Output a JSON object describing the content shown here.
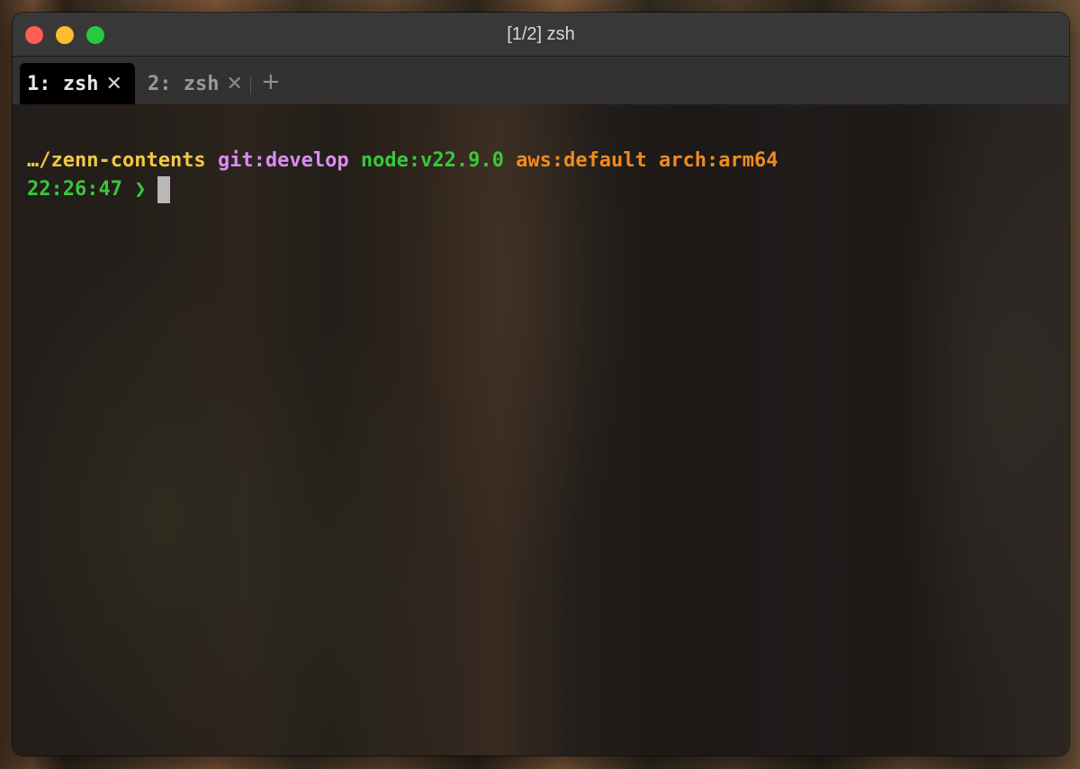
{
  "window": {
    "title": "[1/2] zsh"
  },
  "tabs": [
    {
      "label": "1: zsh",
      "close_icon": "close-icon",
      "active": true
    },
    {
      "label": "2: zsh",
      "close_icon": "close-icon",
      "active": false
    }
  ],
  "new_tab": {
    "icon": "plus-icon",
    "glyph": "+"
  },
  "prompt": {
    "path": "…/zenn-contents",
    "git": "git:develop",
    "node": "node:v22.9.0",
    "aws": "aws:default",
    "arch": "arch:arm64",
    "time": "22:26:47",
    "arrow": "❯"
  },
  "colors": {
    "path": "#f5c842",
    "git": "#d98cf5",
    "node": "#39c83a",
    "aws": "#f08b1f",
    "arch": "#f08b1f",
    "time": "#39c83a",
    "traffic_close": "#ff5f57",
    "traffic_minimize": "#febc2e",
    "traffic_maximize": "#28c840"
  }
}
